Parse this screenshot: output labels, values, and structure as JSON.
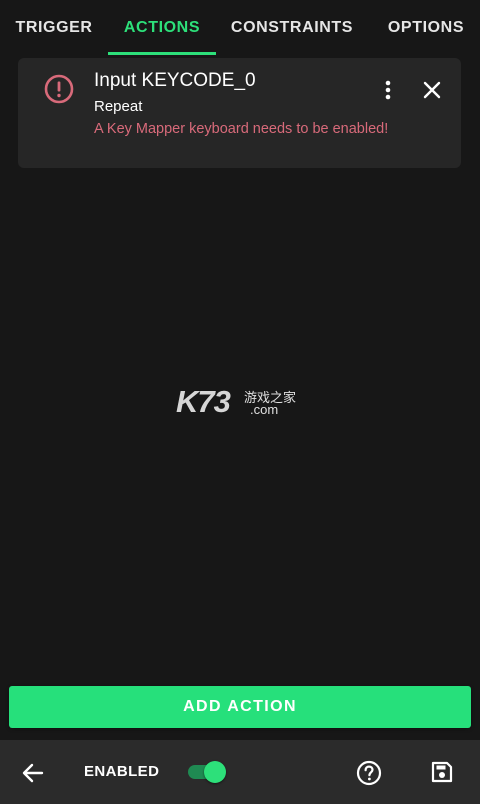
{
  "tabs": {
    "items": [
      {
        "label": "TRIGGER"
      },
      {
        "label": "ACTIONS",
        "active": true
      },
      {
        "label": "CONSTRAINTS"
      },
      {
        "label": "OPTIONS"
      }
    ]
  },
  "action_card": {
    "title": "Input KEYCODE_0",
    "subtitle": "Repeat",
    "error": "A Key Mapper keyboard needs to be enabled!",
    "icon": "error-circle-icon",
    "menu_icon": "more-vert-icon",
    "close_icon": "close-icon"
  },
  "watermark": {
    "brand": "K73",
    "cn_text": "游戏之家",
    "domain": ".com"
  },
  "add_action": {
    "label": "ADD ACTION"
  },
  "bottom_bar": {
    "enabled_label": "ENABLED",
    "enabled": true
  },
  "colors": {
    "accent": "#2de07a",
    "background": "#171717",
    "card": "#262626",
    "error": "#d86a7a"
  }
}
